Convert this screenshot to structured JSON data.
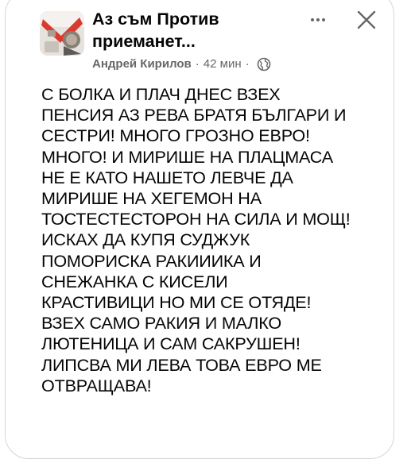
{
  "post": {
    "group_name_line1": "Аз съм Против",
    "group_name_line2": "приеманет...",
    "author": "Андрей Кирилов",
    "separator": "·",
    "time": "42 мин",
    "privacy_icon": "globe-icon",
    "more_icon": "more-dots-icon",
    "close_icon": "close-icon",
    "body": "С БОЛКА И ПЛАЧ ДНЕС ВЗЕХ\nПЕНСИЯ АЗ РЕВА БРАТЯ БЪЛГАРИ И\nСЕСТРИ! МНОГО ГРОЗНО ЕВРО!\nМНОГО! И МИРИШЕ НА ПЛАЦМАСА\nНЕ Е КАТО НАШЕТО ЛЕВЧЕ ДА\nМИРИШЕ НА ХЕГЕМОН НА\nТОСТЕСТЕСТОРОН НА СИЛА И МОЩ!\nИСКАХ ДА КУПЯ СУДЖУК\nПОМОРИСКА РАКИИИКА И\nСНЕЖАНКА С КИСЕЛИ\nКРАСТИВИЦИ НО МИ СЕ ОТЯДЕ!\nВЗЕХ САМО РАКИЯ И МАЛКО\nЛЮТЕНИЦА И САМ САКРУШЕН!\nЛИПСВА МИ ЛЕВА ТОВА ЕВРО МЕ\nОТВРАЩАВА!"
  },
  "colors": {
    "text_primary": "#050505",
    "text_secondary": "#65676b",
    "card_border": "#d3d6db",
    "avatar_accent": "#d93a2f"
  }
}
